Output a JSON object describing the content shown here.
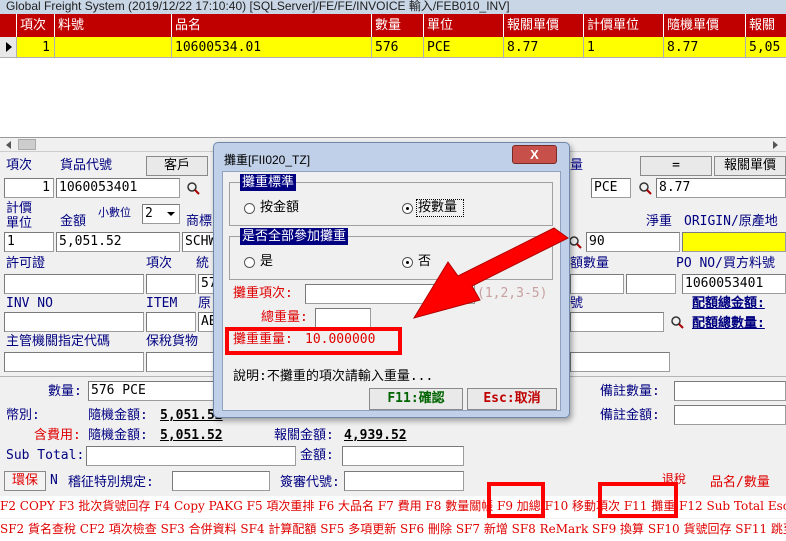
{
  "window": {
    "title": "Global Freight System (2019/12/22 17:10:40) [SQLServer]/FE/FE/INVOICE 輸入/FEB010_INV]"
  },
  "grid": {
    "columns": [
      "項次",
      "料號",
      "品名",
      "數量",
      "單位",
      "報關單價",
      "計價單位",
      "隨機單價",
      "報關"
    ],
    "row": [
      "1",
      "",
      "10600534.01",
      "576",
      "PCE",
      "8.77",
      "1",
      "8.77",
      "5,05"
    ]
  },
  "form": {
    "item_no_label": "項次",
    "item_no": "1",
    "goods_code_label": "貨品代號",
    "goods_code": "1060053401",
    "customer_button": "客戶",
    "qty_label_top": "量",
    "equals_button": "=",
    "decl_price_button": "報關單價",
    "unit_value": "PCE",
    "decl_price_value": "8.77",
    "pricing_unit_label": "計價\n單位",
    "amount_label": "金額",
    "decimal_label": "小數位",
    "decimal_value": "2",
    "brand_label": "商標",
    "net_weight_label": "淨重",
    "origin_label": "ORIGIN/原產地",
    "pricing_unit_value": "1",
    "amount_value": "5,051.52",
    "brand_value": "SCHW",
    "net_weight_value": "90",
    "permit_label": "許可證",
    "item_label": "項次",
    "unified_label": "統",
    "quota_qty_label": "額數量",
    "po_label": "PO NO/買方料號",
    "field_57": "57",
    "po_value": "1060053401",
    "inv_no_label": "INV NO",
    "item_en_label": "ITEM",
    "origin_short_label": "原",
    "num_label": "號",
    "quota_total_amount_label": "配額總金額:",
    "quota_total_qty_label": "配額總數量:",
    "field_ab": "AB",
    "authority_label": "主管機關指定代碼",
    "bonded_label": "保稅貨物",
    "qty_label": "數量:",
    "qty_value": "576 PCE",
    "currency_label": "幣別:",
    "random_amount_label": "隨機金額:",
    "random_amount_value": "5,051.52",
    "incl_fee_label": "含費用:",
    "random_amount_value2": "5,051.52",
    "decl_amount_label": "報關金額:",
    "decl_amount_value": "4,939.52",
    "note_qty_label": "備註數量:",
    "note_amount_label": "備註金額:",
    "subtotal_label": "Sub Total:",
    "amount2_label": "金額:",
    "env_button": "環保",
    "n_label": "N",
    "tax_rule_label": "稽征特別規定:",
    "sign_label": "簽審代號:",
    "returned_label": "退稅",
    "name_qty_label": "品名/數量"
  },
  "dialog": {
    "title": "攤重[FII020_TZ]",
    "close_icon": "X",
    "group1_title": "攤重標準",
    "by_amount": "按金額",
    "by_quantity": "按數量",
    "group2_title": "是否全部參加攤重",
    "yes": "是",
    "no": "否",
    "share_items_label": "攤重項次:",
    "share_items_hint": "(1,2,3-5)",
    "total_weight_label": "總重量:",
    "share_weight_label": "攤重重量:",
    "share_weight_value": "10.000000",
    "note": "說明:不攤重的項次請輸入重量...",
    "confirm_button": "F11:確認",
    "cancel_button": "Esc:取消"
  },
  "fkeys": {
    "line1": "F2 COPY F3 批次貨號回存 F4 Copy PAKG F5 項次重排 F6 大品名 F7 費用 F8 數量關帳 F9 加總 F10 移動項次 F11 攤重 F12 Sub Total Esc 返回",
    "line2": "SF2 貨名查稅 CF2 項次檢查 SF3 合併資料 SF4 計算配額 SF5 多項更新 SF6 刪除 SF7 新增 SF8 ReMark SF9 換算 SF10 貨號回存 SF11 跳至項次"
  },
  "colors": {
    "header_red": "#c00000",
    "row_yellow": "#ffff00",
    "annotation_red": "#ff0000",
    "label_blue": "#000080"
  }
}
